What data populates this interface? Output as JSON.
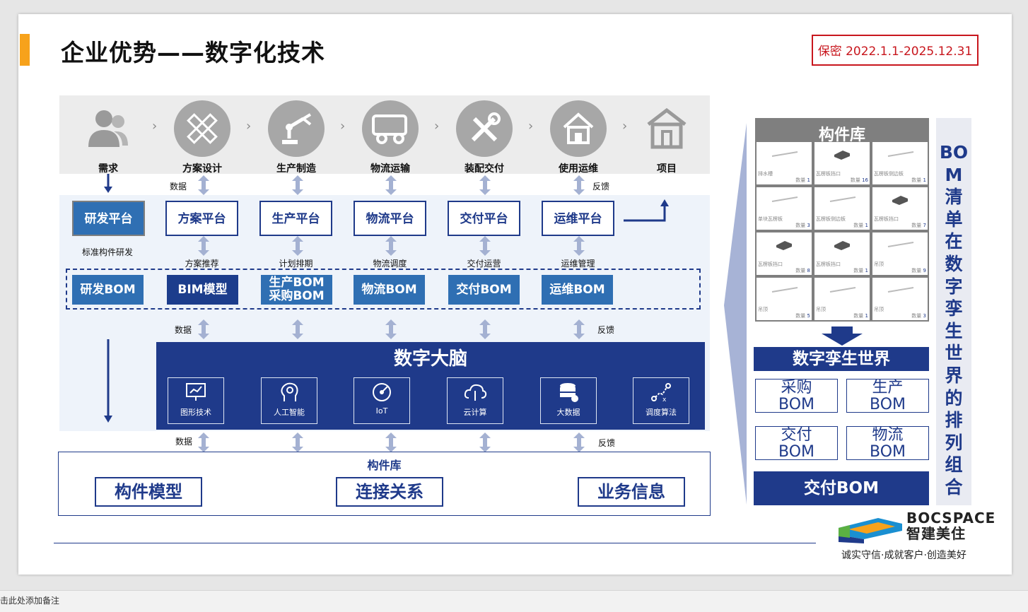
{
  "title": "企业优势——数字化技术",
  "confidential": "保密 2022.1.1-2025.12.31",
  "stages": [
    {
      "label": "需求",
      "icon": "people-icon"
    },
    {
      "label": "方案设计",
      "icon": "ruler-pencil-icon"
    },
    {
      "label": "生产制造",
      "icon": "robot-arm-icon"
    },
    {
      "label": "物流运输",
      "icon": "truck-icon"
    },
    {
      "label": "装配交付",
      "icon": "tools-icon"
    },
    {
      "label": "使用运维",
      "icon": "house-icon"
    },
    {
      "label": "项目",
      "icon": "building-icon"
    }
  ],
  "labels": {
    "data": "数据",
    "feedback": "反馈",
    "std_dev": "标准构件研发"
  },
  "platforms": [
    "研发平台",
    "方案平台",
    "生产平台",
    "物流平台",
    "交付平台",
    "运维平台"
  ],
  "sub_labels": [
    "方案推荐",
    "计划排期",
    "物流调度",
    "交付运营",
    "运维管理"
  ],
  "boms": [
    "研发BOM",
    "BIM模型",
    "生产BOM\n采购BOM",
    "物流BOM",
    "交付BOM",
    "运维BOM"
  ],
  "brain": {
    "title": "数字大脑",
    "techs": [
      {
        "label": "图形技术",
        "icon": "monitor-chart-icon"
      },
      {
        "label": "人工智能",
        "icon": "ai-head-icon"
      },
      {
        "label": "IoT",
        "icon": "iot-icon"
      },
      {
        "label": "云计算",
        "icon": "cloud-icon"
      },
      {
        "label": "大数据",
        "icon": "database-icon"
      },
      {
        "label": "调度算法",
        "icon": "algorithm-icon"
      }
    ]
  },
  "library": {
    "title": "构件库",
    "items": [
      "构件模型",
      "连接关系",
      "业务信息"
    ]
  },
  "component_panel": {
    "title": "构件库",
    "cells": [
      {
        "name": "排水槽",
        "count": "1"
      },
      {
        "name": "瓦楞板挡口",
        "count": "16"
      },
      {
        "name": "瓦楞板侧边板",
        "count": "1"
      },
      {
        "name": "单块瓦楞板",
        "count": "3"
      },
      {
        "name": "瓦楞板侧边板",
        "count": "1"
      },
      {
        "name": "瓦楞板挡口",
        "count": "7"
      },
      {
        "name": "瓦楞板挡口",
        "count": "8"
      },
      {
        "name": "瓦楞板挡口",
        "count": "1"
      },
      {
        "name": "吊顶",
        "count": "9"
      },
      {
        "name": "吊顶",
        "count": "5"
      },
      {
        "name": "吊顶",
        "count": "1"
      },
      {
        "name": "吊顶",
        "count": "3"
      }
    ],
    "count_prefix": "数量"
  },
  "twin": {
    "title": "数字孪生世界",
    "boms": [
      "采购\nBOM",
      "生产\nBOM",
      "交付\nBOM",
      "物流\nBOM"
    ],
    "delivery": "交付BOM"
  },
  "vertical_text": [
    "BO",
    "M",
    "清",
    "单",
    "在",
    "数",
    "字",
    "孪",
    "生",
    "世",
    "界",
    "的",
    "排",
    "列",
    "组",
    "合"
  ],
  "brand": {
    "name_en": "BOCSPACE",
    "name_cn": "智建美住",
    "slogan": "诚实守信·成就客户·创造美好"
  },
  "notes_placeholder": "击此处添加备注",
  "colors": {
    "navy": "#1f3a8a",
    "blue": "#2f6fb3",
    "orange": "#f7a21b",
    "red": "#c8161d"
  }
}
